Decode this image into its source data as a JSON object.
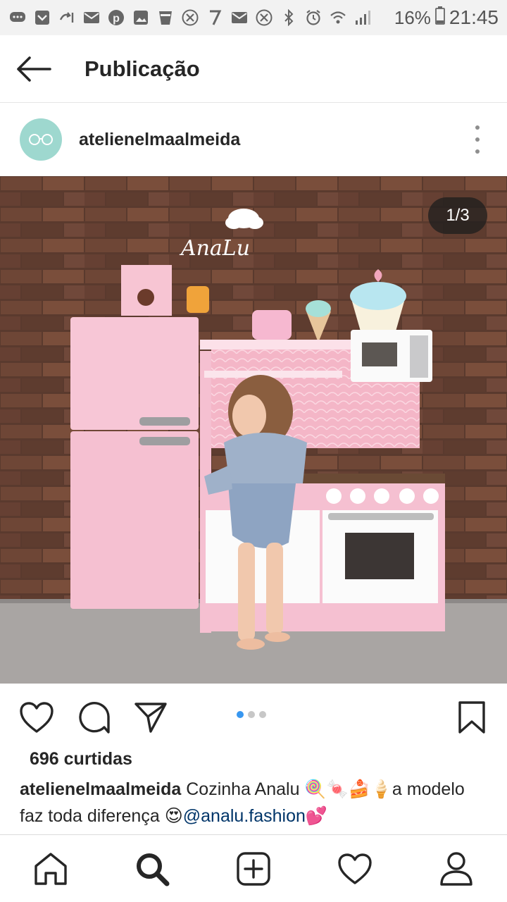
{
  "status_bar": {
    "battery_percent": "16%",
    "time": "21:45"
  },
  "header": {
    "title": "Publicação"
  },
  "post": {
    "username": "atelienelmaalmeida",
    "image_counter": "1/3",
    "image_sign_text": "AnaLu",
    "carousel": {
      "total": 3,
      "active_index": 0
    },
    "likes": "696 curtidas",
    "caption": {
      "username": "atelienelmaalmeida",
      "text_part1": " Cozinha Analu 🍭🍬🍰🍦a modelo faz toda diferença 😍",
      "mention": "@analu.fashion",
      "text_part2": "💕"
    }
  },
  "icons": {
    "back": "arrow-left-icon",
    "more": "more-vertical-icon",
    "like": "heart-icon",
    "comment": "comment-icon",
    "share": "send-icon",
    "save": "bookmark-icon",
    "nav": [
      "home-icon",
      "search-icon",
      "add-post-icon",
      "activity-heart-icon",
      "profile-icon"
    ]
  },
  "colors": {
    "accent_blue": "#3897f0",
    "mention": "#003569",
    "text": "#262626",
    "avatar_bg": "#9ed8cf"
  }
}
